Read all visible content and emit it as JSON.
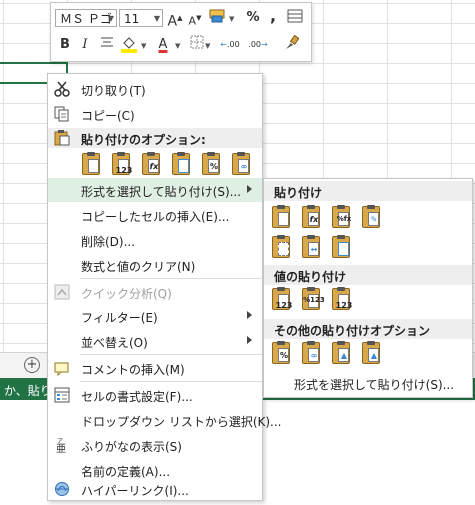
{
  "mini_toolbar": {
    "font_name": "ＭＳ Ｐゴ",
    "font_size": "11",
    "grow_font": "A",
    "shrink_font": "A",
    "percent": "%",
    "comma": ",",
    "bold": "B",
    "italic": "I",
    "font_color_letter": "A",
    "decimal_increase": ".00",
    "decimal_decrease": ".00"
  },
  "context_menu": {
    "items": [
      {
        "label": "切り取り(T)",
        "icon": "scissors-icon"
      },
      {
        "label": "コピー(C)",
        "icon": "copy-icon"
      },
      {
        "label": "貼り付けのオプション:",
        "icon": "paste-icon",
        "header": true
      },
      {
        "label": "形式を選択して貼り付け(S)...",
        "submenu": true,
        "highlighted": true
      },
      {
        "label": "コピーしたセルの挿入(E)..."
      },
      {
        "label": "削除(D)..."
      },
      {
        "label": "数式と値のクリア(N)"
      },
      {
        "label": "クイック分析(Q)",
        "icon": "quick-analysis-icon",
        "disabled": true
      },
      {
        "label": "フィルター(E)",
        "submenu": true
      },
      {
        "label": "並べ替え(O)",
        "submenu": true
      },
      {
        "label": "コメントの挿入(M)",
        "icon": "comment-icon"
      },
      {
        "label": "セルの書式設定(F)...",
        "icon": "format-cells-icon"
      },
      {
        "label": "ドロップダウン リストから選択(K)..."
      },
      {
        "label": "ふりがなの表示(S)",
        "icon": "furigana-icon"
      },
      {
        "label": "名前の定義(A)..."
      },
      {
        "label": "ハイパーリンク(I)...",
        "icon": "hyperlink-icon"
      }
    ],
    "paste_options": [
      "",
      "123",
      "fx",
      "",
      "%",
      ""
    ]
  },
  "paste_submenu": {
    "group1_title": "貼り付け",
    "group1": [
      "",
      "fx",
      "%fx",
      "",
      "",
      "",
      ""
    ],
    "group2_title": "値の貼り付け",
    "group2": [
      "123",
      "%123",
      "123"
    ],
    "group3_title": "その他の貼り付けオプション",
    "group3": [
      "%",
      "",
      "",
      ""
    ],
    "link_label": "形式を選択して貼り付け(S)..."
  },
  "status_bar": {
    "text": "か、貼り付"
  },
  "sheet_bar": {
    "add_sheet": "+"
  },
  "colors": {
    "excel_green": "#217346",
    "highlight": "#e0efe4",
    "font_color_bar": "#e03131",
    "highlight_bar": "#ffeb00"
  }
}
